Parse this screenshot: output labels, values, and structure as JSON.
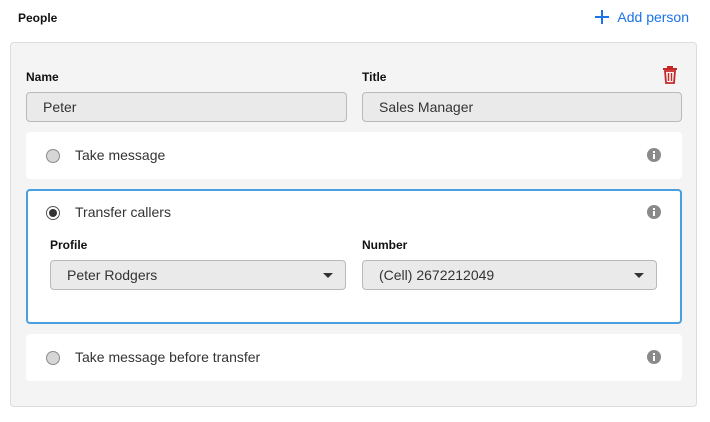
{
  "header": {
    "section_title": "People",
    "add_person_label": "Add person"
  },
  "person": {
    "name_label": "Name",
    "name_value": "Peter",
    "title_label": "Title",
    "title_value": "Sales Manager"
  },
  "options": [
    {
      "label": "Take message",
      "selected": false
    },
    {
      "label": "Transfer callers",
      "selected": true,
      "profile_label": "Profile",
      "profile_value": "Peter Rodgers",
      "number_label": "Number",
      "number_value": "(Cell) 2672212049"
    },
    {
      "label": "Take message before transfer",
      "selected": false
    }
  ],
  "colors": {
    "accent": "#1a73e8",
    "selected_border": "#4a9fe0",
    "delete": "#c62828",
    "info": "#8a8a8a"
  },
  "icons": {
    "add": "plus-icon",
    "delete": "trash-icon",
    "info": "info-icon",
    "dropdown": "caret-down-icon"
  }
}
